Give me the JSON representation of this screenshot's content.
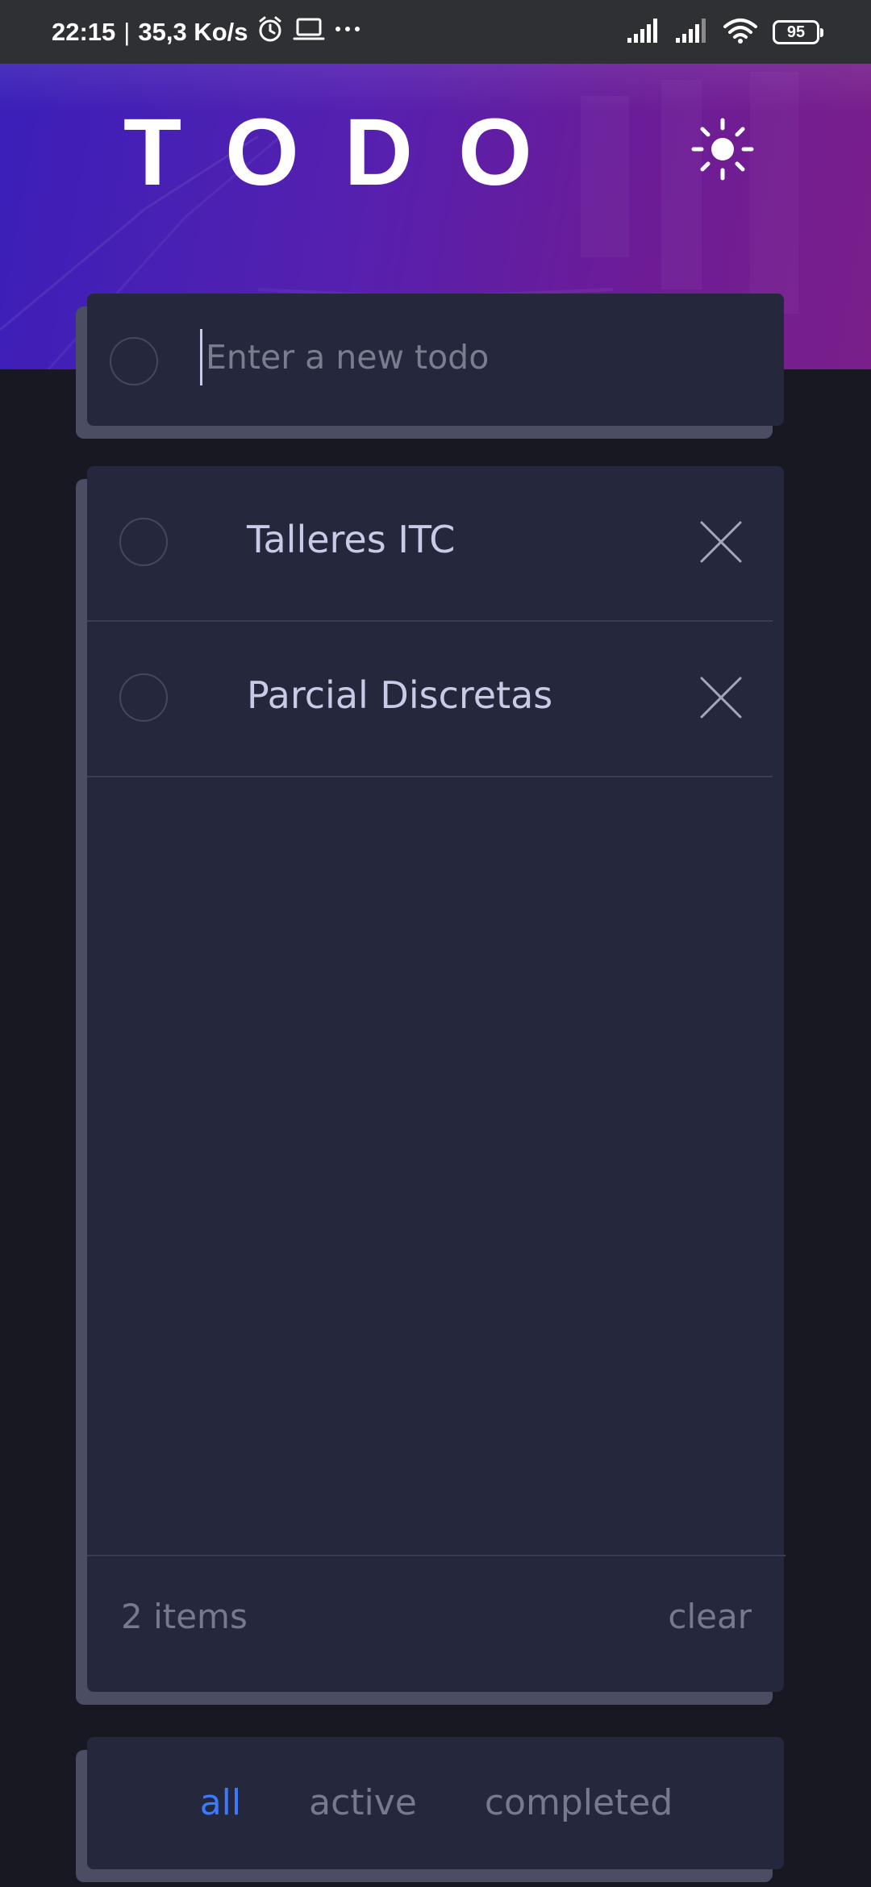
{
  "status_bar": {
    "time": "22:15",
    "separator": "|",
    "speed": "35,3 Ko/s",
    "battery": "95",
    "icon_names": [
      "alarm-icon",
      "laptop-icon",
      "more-icon",
      "signal-icon",
      "signal-icon",
      "wifi-icon",
      "battery-icon"
    ]
  },
  "header": {
    "title": "TODO",
    "theme_icon": "sun-icon"
  },
  "new_todo": {
    "placeholder": "Enter a new todo",
    "value": ""
  },
  "todos": [
    {
      "text": "Talleres ITC",
      "completed": false
    },
    {
      "text": "Parcial Discretas",
      "completed": false
    }
  ],
  "footer": {
    "items_left": "2 items",
    "clear_label": "clear"
  },
  "filters": {
    "all": "all",
    "active": "active",
    "completed": "completed",
    "selected": "all"
  },
  "colors": {
    "background": "#171822",
    "card": "#25273c",
    "card_edge": "#4b4d63",
    "text": "#c8cbe7",
    "muted": "#77798f",
    "accent": "#3a7bfd",
    "hero_start": "#3a1fb8",
    "hero_end": "#7a1f8a"
  }
}
